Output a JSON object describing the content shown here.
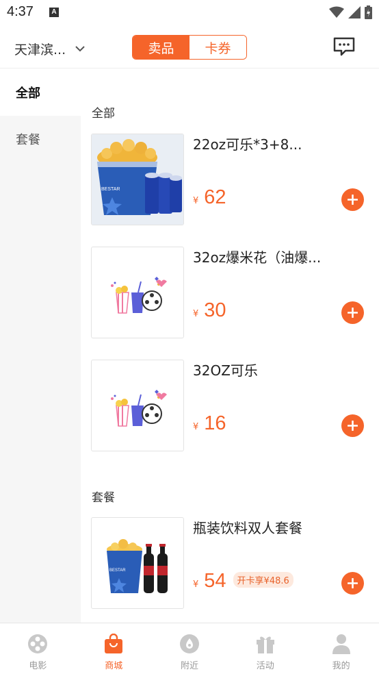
{
  "status_bar": {
    "time": "4:37",
    "notification_letter": "A"
  },
  "header": {
    "city": "天津滨...",
    "tabs": [
      {
        "label": "卖品",
        "active": true
      },
      {
        "label": "卡券",
        "active": false
      }
    ]
  },
  "sidebar": {
    "items": [
      {
        "label": "全部",
        "active": true
      },
      {
        "label": "套餐",
        "active": false
      }
    ]
  },
  "main": {
    "sections": [
      {
        "title": "全部",
        "products": [
          {
            "name": "22oz可乐*3+8...",
            "currency": "¥",
            "price": "62",
            "image": "popcorn-bucket-with-cola-cups"
          },
          {
            "name": "32oz爆米花（油爆...",
            "currency": "¥",
            "price": "30",
            "image": "placeholder-popcorn-film-reel"
          },
          {
            "name": "32OZ可乐",
            "currency": "¥",
            "price": "16",
            "image": "placeholder-popcorn-film-reel"
          }
        ]
      },
      {
        "title": "套餐",
        "products": [
          {
            "name": "瓶装饮料双人套餐",
            "currency": "¥",
            "price": "54",
            "member_price": "开卡享¥48.6",
            "image": "popcorn-bucket-with-cola-bottles"
          }
        ]
      }
    ]
  },
  "bottom_nav": {
    "items": [
      {
        "label": "电影",
        "icon": "film-reel-icon",
        "active": false
      },
      {
        "label": "商城",
        "icon": "shopping-bag-icon",
        "active": true
      },
      {
        "label": "附近",
        "icon": "location-icon",
        "active": false
      },
      {
        "label": "活动",
        "icon": "gift-icon",
        "active": false
      },
      {
        "label": "我的",
        "icon": "person-icon",
        "active": false
      }
    ]
  },
  "colors": {
    "accent": "#f5642a",
    "inactive_nav": "#c8c8c8"
  }
}
